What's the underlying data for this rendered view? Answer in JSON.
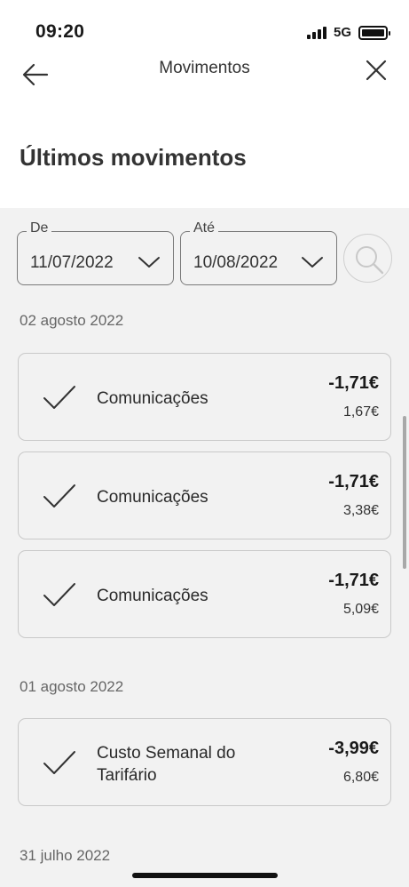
{
  "status_bar": {
    "time": "09:20",
    "network": "5G",
    "battery_percent": 100
  },
  "nav": {
    "title": "Movimentos"
  },
  "page": {
    "title": "Últimos movimentos"
  },
  "filters": {
    "from": {
      "label": "De",
      "value": "11/07/2022"
    },
    "to": {
      "label": "Até",
      "value": "10/08/2022"
    }
  },
  "groups": [
    {
      "date": "02 agosto 2022",
      "items": [
        {
          "description": "Comunicações",
          "amount": "-1,71€",
          "balance": "1,67€"
        },
        {
          "description": "Comunicações",
          "amount": "-1,71€",
          "balance": "3,38€"
        },
        {
          "description": "Comunicações",
          "amount": "-1,71€",
          "balance": "5,09€"
        }
      ]
    },
    {
      "date": "01 agosto 2022",
      "items": [
        {
          "description_line1": "Custo Semanal do",
          "description_line2": "Tarifário",
          "amount": "-3,99€",
          "balance": "6,80€"
        }
      ]
    },
    {
      "date": "31 julho 2022",
      "items": []
    }
  ]
}
